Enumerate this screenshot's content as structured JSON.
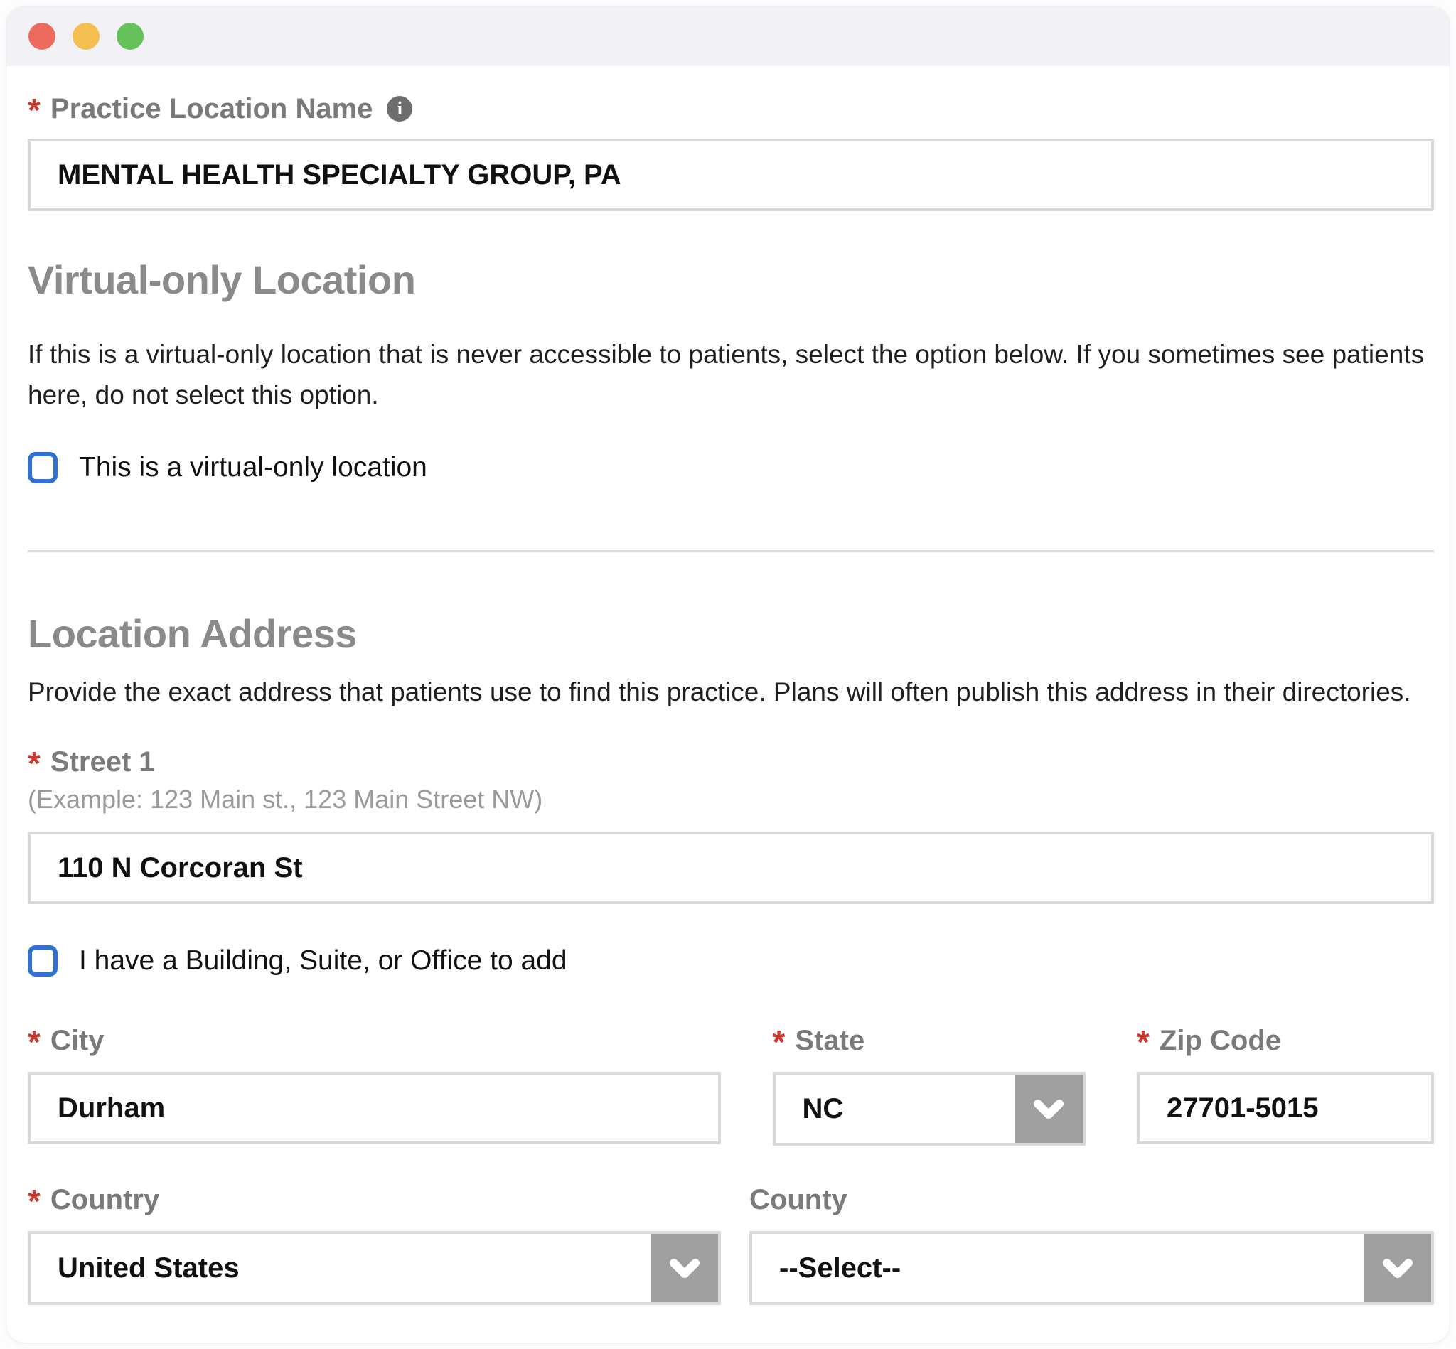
{
  "colors": {
    "required_red": "#c9362c",
    "checkbox_blue": "#2e71d3",
    "chevron_gray": "#a0a0a0",
    "titlebar_bg": "#f2f1f6",
    "traffic_red": "#ec6a5e",
    "traffic_yellow": "#f4bf50",
    "traffic_green": "#65c159"
  },
  "misc": {
    "required_marker": "*",
    "info_glyph": "i"
  },
  "sections": {
    "virtual": {
      "heading": "Virtual-only Location",
      "description": "If this is a virtual-only location that is never accessible to patients, select the option below. If you sometimes see patients here, do not select this option.",
      "checkbox_label": "This is a virtual-only location",
      "checkbox_checked": false
    },
    "address": {
      "heading": "Location Address",
      "description": "Provide the exact address that patients use to find this practice. Plans will often publish this address in their directories.",
      "building_checkbox_label": "I have a Building, Suite, or Office to add",
      "building_checkbox_checked": false
    }
  },
  "fields": {
    "practice_name": {
      "label": "Practice Location Name",
      "value": "MENTAL HEALTH SPECIALTY GROUP, PA",
      "required": true
    },
    "street1": {
      "label": "Street 1",
      "hint": "(Example: 123 Main st., 123 Main Street NW)",
      "value": "110 N Corcoran St",
      "required": true
    },
    "city": {
      "label": "City",
      "value": "Durham",
      "required": true
    },
    "state": {
      "label": "State",
      "value": "NC",
      "required": true
    },
    "zip": {
      "label": "Zip Code",
      "value": "27701-5015",
      "required": true
    },
    "country": {
      "label": "Country",
      "value": "United States",
      "required": true
    },
    "county": {
      "label": "County",
      "value": "--Select--",
      "required": false
    }
  }
}
